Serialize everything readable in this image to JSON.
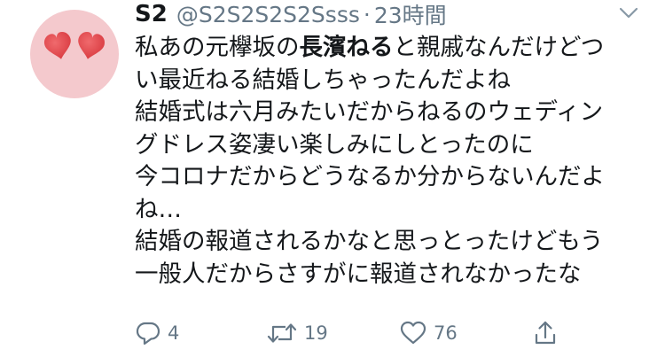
{
  "tweet": {
    "display_name": "S2",
    "handle": "@S2S2S2S2Ssss",
    "separator": "·",
    "timestamp": "23時間",
    "body": {
      "line1_pre": "私あの元欅坂の",
      "line1_mention": "長濱ねる",
      "line1_post": "と親戚なんだけどつ",
      "line2": "い最近ねる結婚しちゃったんだよね",
      "line3": "結婚式は六月みたいだからねるのウェディン",
      "line4": "グドレス姿凄い楽しみにしとったのに",
      "line5": "今コロナだからどうなるか分からないんだよ",
      "line6": "ね…",
      "line7": "結婚の報道されるかなと思っとったけどもう",
      "line8": "一般人だからさすがに報道されなかったな"
    },
    "actions": {
      "reply_count": "4",
      "retweet_count": "19",
      "like_count": "76"
    },
    "icons": {
      "avatar": "heart-eyes-avatar",
      "caret": "chevron-down-icon",
      "reply": "reply-icon",
      "retweet": "retweet-icon",
      "like": "heart-icon",
      "share": "share-icon"
    },
    "colors": {
      "text": "#14171a",
      "secondary": "#657786",
      "avatar_bg": "#f4c9cd",
      "heart": "#e0474c"
    }
  }
}
